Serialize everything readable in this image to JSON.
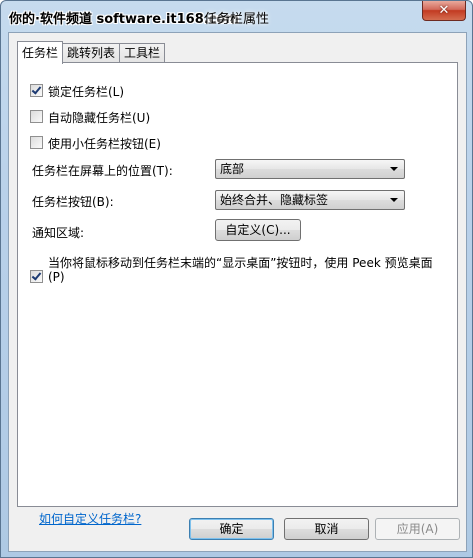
{
  "window": {
    "title": "任务栏属性",
    "watermark": "你的·软件频道 software.it168.com",
    "close_glyph": "✕"
  },
  "tabs": [
    {
      "label": "任务栏",
      "active": true
    },
    {
      "label": "跳转列表",
      "active": false
    },
    {
      "label": "工具栏",
      "active": false
    }
  ],
  "options": {
    "lock_taskbar": {
      "label": "锁定任务栏(L)",
      "checked": true
    },
    "auto_hide": {
      "label": "自动隐藏任务栏(U)",
      "checked": false
    },
    "small_buttons": {
      "label": "使用小任务栏按钮(E)",
      "checked": false
    }
  },
  "location": {
    "label": "任务栏在屏幕上的位置(T):",
    "value": "底部"
  },
  "buttons_mode": {
    "label": "任务栏按钮(B):",
    "value": "始终合并、隐藏标签"
  },
  "notification": {
    "label": "通知区域:",
    "button": "自定义(C)..."
  },
  "peek": {
    "line1": "当你将鼠标移动到任务栏末端的“显示桌面”按钮时，使用 Peek 预览桌面",
    "line2": "(P)",
    "checked": true
  },
  "help_link": "如何自定义任务栏?",
  "footer": {
    "ok": "确定",
    "cancel": "取消",
    "apply": "应用(A)"
  }
}
